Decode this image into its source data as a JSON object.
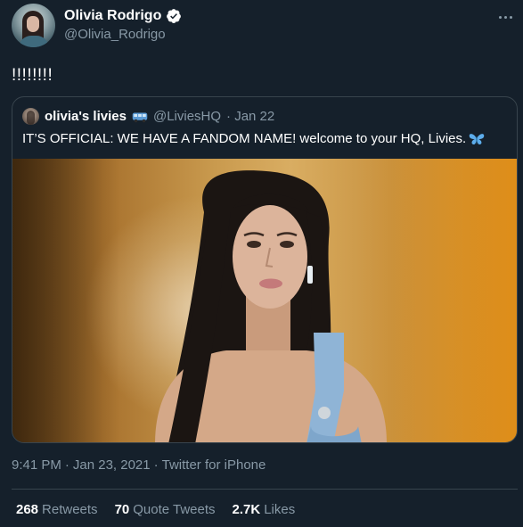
{
  "author": {
    "display_name": "Olivia Rodrigo",
    "handle": "@Olivia_Rodrigo",
    "verified_icon": "verified-badge"
  },
  "tweet": {
    "text": "!!!!!!!!"
  },
  "quoted": {
    "display_name": "olivia's livies",
    "name_emoji": "bus-emoji",
    "handle": "@LiviesHQ",
    "date": "· Jan 22",
    "text": "IT’S OFFICIAL: WE HAVE A FANDOM NAME! welcome to your HQ, Livies.",
    "text_emoji": "butterfly-emoji"
  },
  "meta": {
    "time": "9:41 PM",
    "separator1": "·",
    "date": "Jan 23, 2021",
    "separator2": "·",
    "source": "Twitter for iPhone"
  },
  "stats": {
    "retweets_count": "268",
    "retweets_label": "Retweets",
    "quotes_count": "70",
    "quotes_label": "Quote Tweets",
    "likes_count": "2.7K",
    "likes_label": "Likes"
  },
  "colors": {
    "background": "#15202b",
    "secondary_text": "#8899a6",
    "border": "#38444d",
    "verified": "#ffffff"
  }
}
